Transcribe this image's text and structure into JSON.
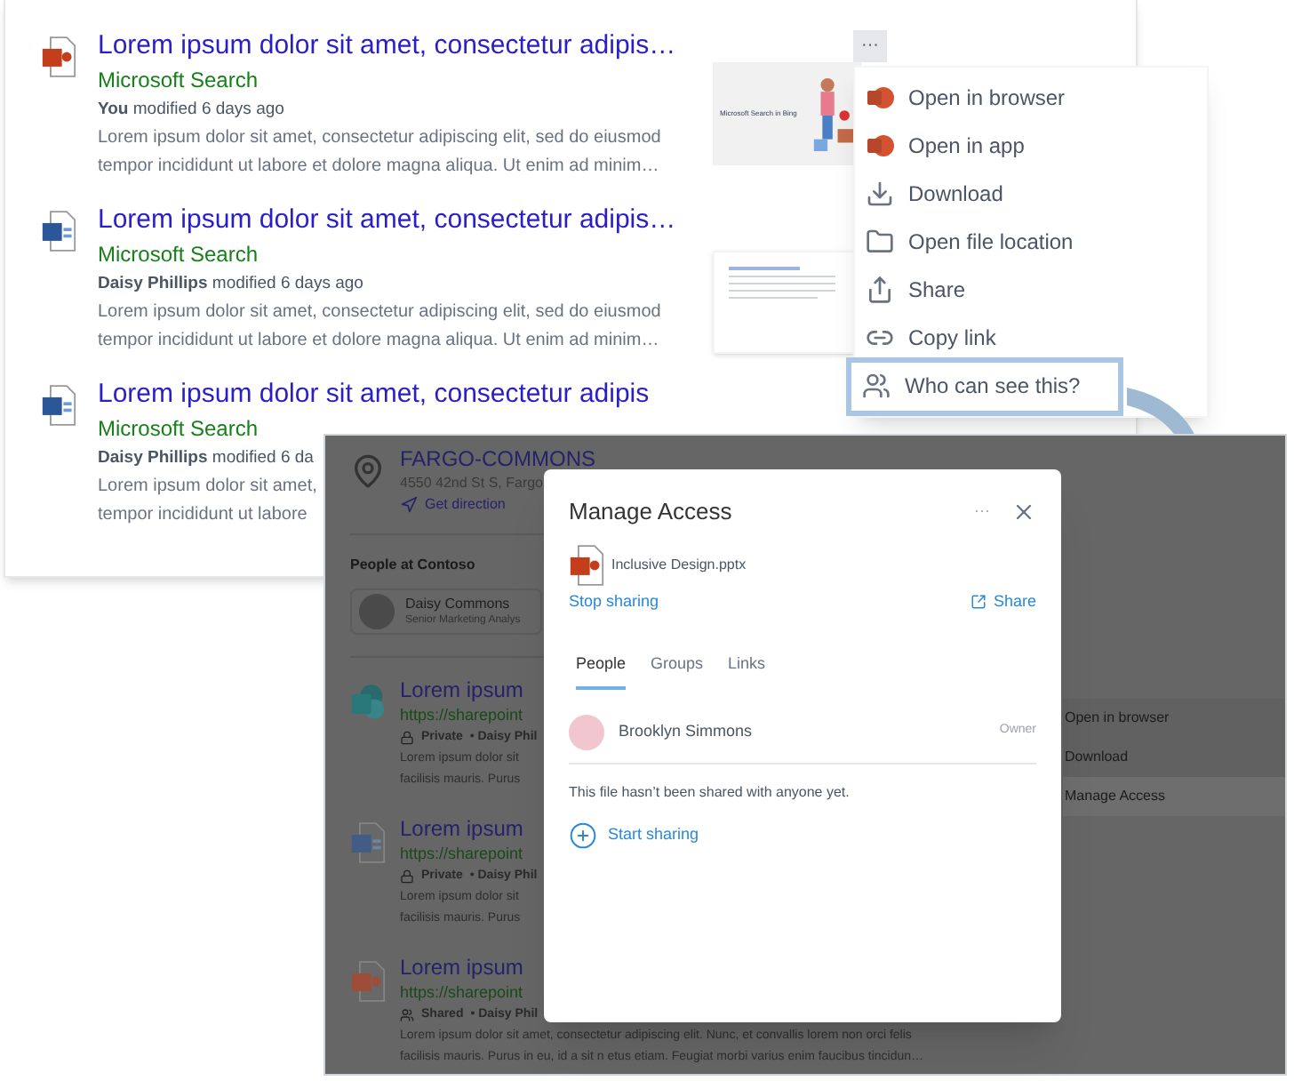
{
  "search_results": [
    {
      "kind": "powerpoint",
      "title": "Lorem ipsum dolor sit amet, consectetur adipis…",
      "source": "Microsoft Search",
      "author": "You",
      "modified": "modified 6 days ago",
      "snippet": [
        "Lorem ipsum dolor sit amet, consectetur adipiscing elit, sed do eiusmod",
        "tempor incididunt ut labore et dolore magna aliqua. Ut enim ad minim…"
      ],
      "thumbnail": "Microsoft Search in Bing"
    },
    {
      "kind": "word",
      "title": "Lorem ipsum dolor sit amet, consectetur adipis…",
      "source": "Microsoft Search",
      "author": "Daisy Phillips",
      "modified": "modified 6 days ago",
      "snippet": [
        "Lorem ipsum dolor sit amet, consectetur adipiscing elit, sed do eiusmod",
        "tempor incididunt ut labore et dolore magna aliqua. Ut enim ad minim…"
      ]
    },
    {
      "kind": "word",
      "title": "Lorem ipsum dolor sit amet, consectetur adipis",
      "source": "Microsoft Search",
      "author": "Daisy Phillips",
      "modified": "modified 6 da",
      "snippet": [
        "Lorem ipsum dolor sit amet,",
        "tempor incididunt ut labore"
      ]
    }
  ],
  "more_button": "···",
  "context_menu": [
    {
      "kind": "powerpoint",
      "label": "Open in browser",
      "highlighted": false
    },
    {
      "kind": "powerpoint",
      "label": "Open in app",
      "highlighted": false
    },
    {
      "kind": "download",
      "label": "Download",
      "highlighted": false
    },
    {
      "kind": "folder",
      "label": "Open file location",
      "highlighted": false
    },
    {
      "kind": "share",
      "label": "Share",
      "highlighted": false
    },
    {
      "kind": "link",
      "label": "Copy link",
      "highlighted": false
    },
    {
      "kind": "people",
      "label": "Who can see this?",
      "highlighted": true
    }
  ],
  "background_page": {
    "location": {
      "name": "FARGO-COMMONS",
      "address": "4550 42nd St S, Fargo",
      "action": "Get direction"
    },
    "people_heading": "People at Contoso",
    "person": {
      "name": "Daisy Commons",
      "title": "Senior Marketing Analys"
    },
    "results": [
      {
        "kind": "sharepoint",
        "title": "Lorem ipsum",
        "url": "https://sharepoint",
        "visibility": "Private",
        "author": "• Daisy Phil",
        "snippet": [
          "Lorem ipsum dolor sit",
          "facilisis mauris. Purus"
        ]
      },
      {
        "kind": "word",
        "title": "Lorem ipsum",
        "url": "https://sharepoint",
        "visibility": "Private",
        "author": "• Daisy Phil",
        "snippet": [
          "Lorem ipsum dolor sit",
          "facilisis mauris. Purus"
        ]
      },
      {
        "kind": "powerpoint",
        "title": "Lorem ipsum",
        "url": "https://sharepoint",
        "visibility": "Shared",
        "author": "• Daisy Phil",
        "snippet": [
          "Lorem ipsum dolor sit amet, consectetur adipiscing elit. Nunc, et convallis lorem non orci felis",
          "facilisis mauris. Purus in eu, id a sit n etus etiam. Feugiat morbi varius enim faucibus tincidun…"
        ]
      }
    ],
    "menu": [
      {
        "label": "Open in browser",
        "selected": false
      },
      {
        "label": "Download",
        "selected": false
      },
      {
        "label": "Manage Access",
        "selected": true
      }
    ]
  },
  "dialog": {
    "title": "Manage Access",
    "more": "···",
    "file": "Inclusive Design.pptx",
    "stop_sharing": "Stop sharing",
    "share": "Share",
    "tabs": [
      {
        "label": "People",
        "selected": true
      },
      {
        "label": "Groups",
        "selected": false
      },
      {
        "label": "Links",
        "selected": false
      }
    ],
    "owner": {
      "name": "Brooklyn Simmons",
      "role": "Owner"
    },
    "message": "This file hasn’t been shared with anyone yet.",
    "start_sharing": "Start sharing"
  }
}
